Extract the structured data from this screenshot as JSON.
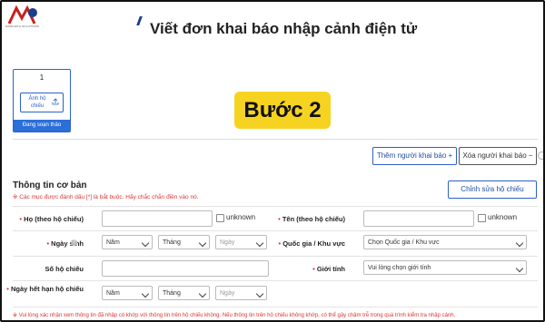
{
  "page": {
    "title": "Viết đơn khai báo nhập cảnh điện tử",
    "logo_text": "MANGHOU SOLUTIONS"
  },
  "card": {
    "number": "1",
    "upload_label": "Ảnh hộ chiếu",
    "status": "Đang soạn thảo"
  },
  "step_badge": "Bước 2",
  "actions": {
    "add_person": "Thêm người khai báo +",
    "remove_person": "Xóa người khai báo −",
    "edit_passport": "Chỉnh sửa hộ chiếu"
  },
  "section": {
    "title": "Thông tin cơ bản",
    "note": "※ Các mục được đánh dấu [*] là bắt buộc. Hãy chắc chắn điền vào nó."
  },
  "form": {
    "surname_label": "Họ (theo hộ chiếu)",
    "given_label": "Tên (theo hộ chiếu)",
    "unknown": "unknown",
    "dob_label": "Ngày sinh",
    "year_ph": "Năm",
    "month_ph": "Tháng",
    "day_ph": "Ngày",
    "country_label": "Quốc gia / Khu vực",
    "country_ph": "Chọn Quốc gia / Khu vực",
    "passport_label": "Số hộ chiếu",
    "gender_label": "Giới tính",
    "gender_ph": "Vui lòng chọn giới tính",
    "expiry_label": "Ngày hết hạn hộ chiếu"
  },
  "footer": "※ Vui lòng xác nhận xem thông tin đã nhập có khớp với thông tin trên hộ chiếu không. Nếu thông tin trên hộ chiếu không khớp, có thể gây chậm trễ trong quá trình kiểm tra nhập cảnh,"
}
